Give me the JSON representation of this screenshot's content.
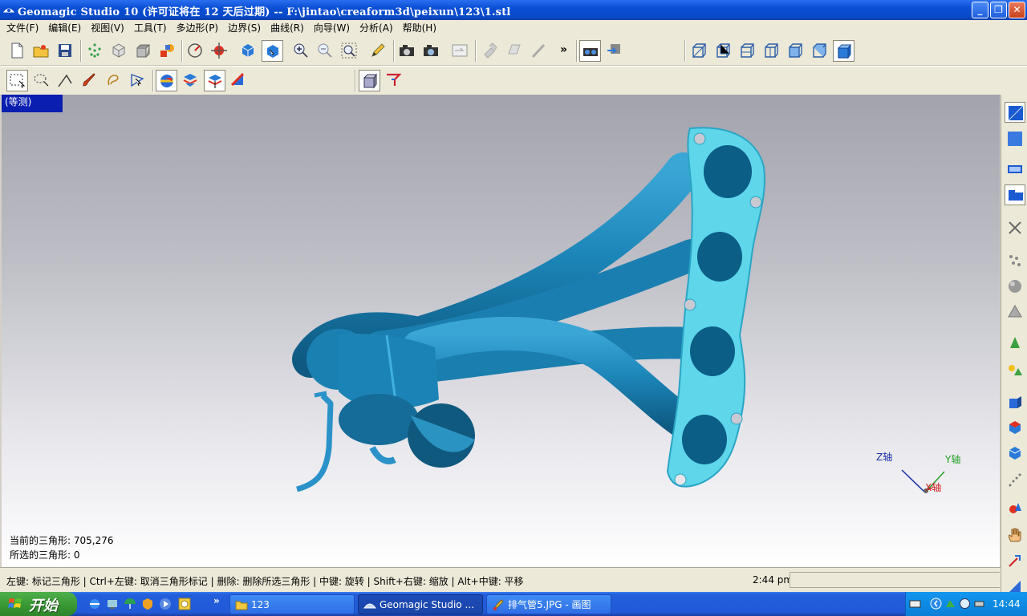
{
  "window": {
    "title": "Geomagic Studio 10 (许可证将在 12 天后过期) -- F:\\jintao\\creaform3d\\peixun\\123\\1.stl",
    "minimize_glyph": "_",
    "restore_glyph": "❐",
    "close_glyph": "✕"
  },
  "menu": [
    "文件(F)",
    "编辑(E)",
    "视图(V)",
    "工具(T)",
    "多边形(P)",
    "边界(S)",
    "曲线(R)",
    "向导(W)",
    "分析(A)",
    "帮助(H)"
  ],
  "toolbar": {
    "overflow_glyph": "»"
  },
  "viewport": {
    "view_label": "(等测)",
    "axes": {
      "z": "Z轴",
      "y": "Y轴",
      "x": "X轴"
    },
    "axis_colors": {
      "z": "#1a2fa8",
      "y": "#22a022",
      "x": "#d01818"
    },
    "model_color": "#1c86b8",
    "flange_color": "#5fd6ea"
  },
  "info": {
    "current_triangles": "当前的三角形: 705,276",
    "selected_triangles": "所选的三角形: 0"
  },
  "statusbar": {
    "hint": "左键: 标记三角形 | Ctrl+左键: 取消三角形标记 | 删除: 删除所选三角形 | 中键: 旋转 | Shift+右键: 缩放 | Alt+中键: 平移",
    "time": "2:44 pm"
  },
  "taskbar": {
    "start_label": "开始",
    "more_glyph": "»",
    "tasks": [
      {
        "label": "123",
        "icon": "folder-icon"
      },
      {
        "label": "Geomagic Studio ...",
        "icon": "geomagic-icon"
      },
      {
        "label": "排气管5.JPG - 画图",
        "icon": "paint-icon"
      }
    ],
    "clock": "14:44"
  }
}
